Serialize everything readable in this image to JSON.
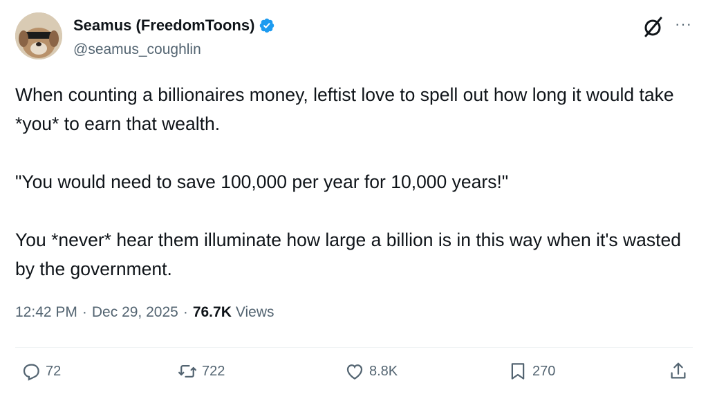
{
  "author": {
    "display_name": "Seamus (FreedomToons)",
    "handle": "@seamus_coughlin",
    "verified": true,
    "avatar": "dog-with-sunglasses"
  },
  "tweet": {
    "paragraphs": [
      "When counting a billionaires money, leftist love to spell out how long it would take *you* to earn that wealth.",
      "\"You would need to save 100,000 per year for 10,000 years!\"",
      "You *never* hear them illuminate how large a billion is in this way when it's wasted by the government."
    ],
    "time": "12:42 PM",
    "date": "Dec 29, 2025",
    "separator": "·",
    "views_count": "76.7K",
    "views_label": "Views"
  },
  "actions": {
    "replies": "72",
    "reposts": "722",
    "likes": "8.8K",
    "bookmarks": "270"
  },
  "icons": [
    "grok-icon",
    "more-icon",
    "reply-icon",
    "repost-icon",
    "like-icon",
    "bookmark-icon",
    "share-icon",
    "verified-badge-icon"
  ],
  "colors": {
    "text": "#0f1419",
    "secondary": "#536471",
    "verified": "#1d9bf0"
  }
}
